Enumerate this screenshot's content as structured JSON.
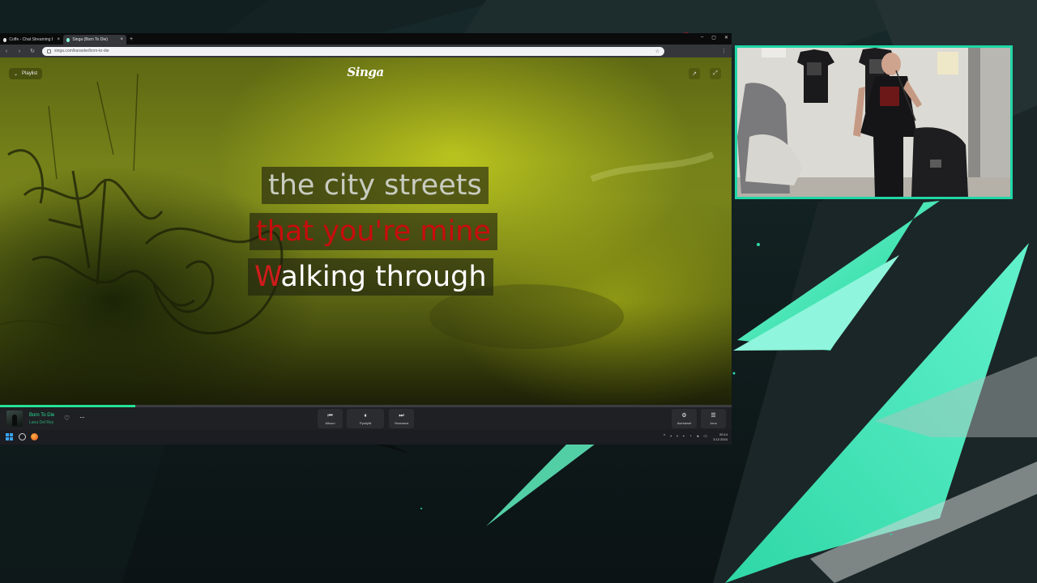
{
  "browser": {
    "tabs": [
      {
        "label": "Coffe - Chat Streaming Bot",
        "active": false
      },
      {
        "label": "Singa (Born To Die)",
        "active": true
      }
    ],
    "new_tab": "+",
    "address": "singa.com/karaoke/born-to-die"
  },
  "singa": {
    "playlist_label": "Playlist",
    "logo": "Singa",
    "lyrics": {
      "line1": "the city streets",
      "line2": "that you're mine",
      "line3_sung": "W",
      "line3_rest": "alking through"
    }
  },
  "player": {
    "progress": 0.185,
    "song_title": "Born To Die",
    "artist": "Lana Del Rey",
    "controls": {
      "previous": "Alkuun",
      "pause": "Pysäytä",
      "next": "Seuraava",
      "settings": "Asetukset",
      "queue": "Jono"
    }
  },
  "taskbar": {
    "time": "20:14",
    "date": "3.12.2024"
  },
  "colors": {
    "accent": "#27e094",
    "frame": "#1fd6a6",
    "lyric_active": "#c80c0c"
  }
}
